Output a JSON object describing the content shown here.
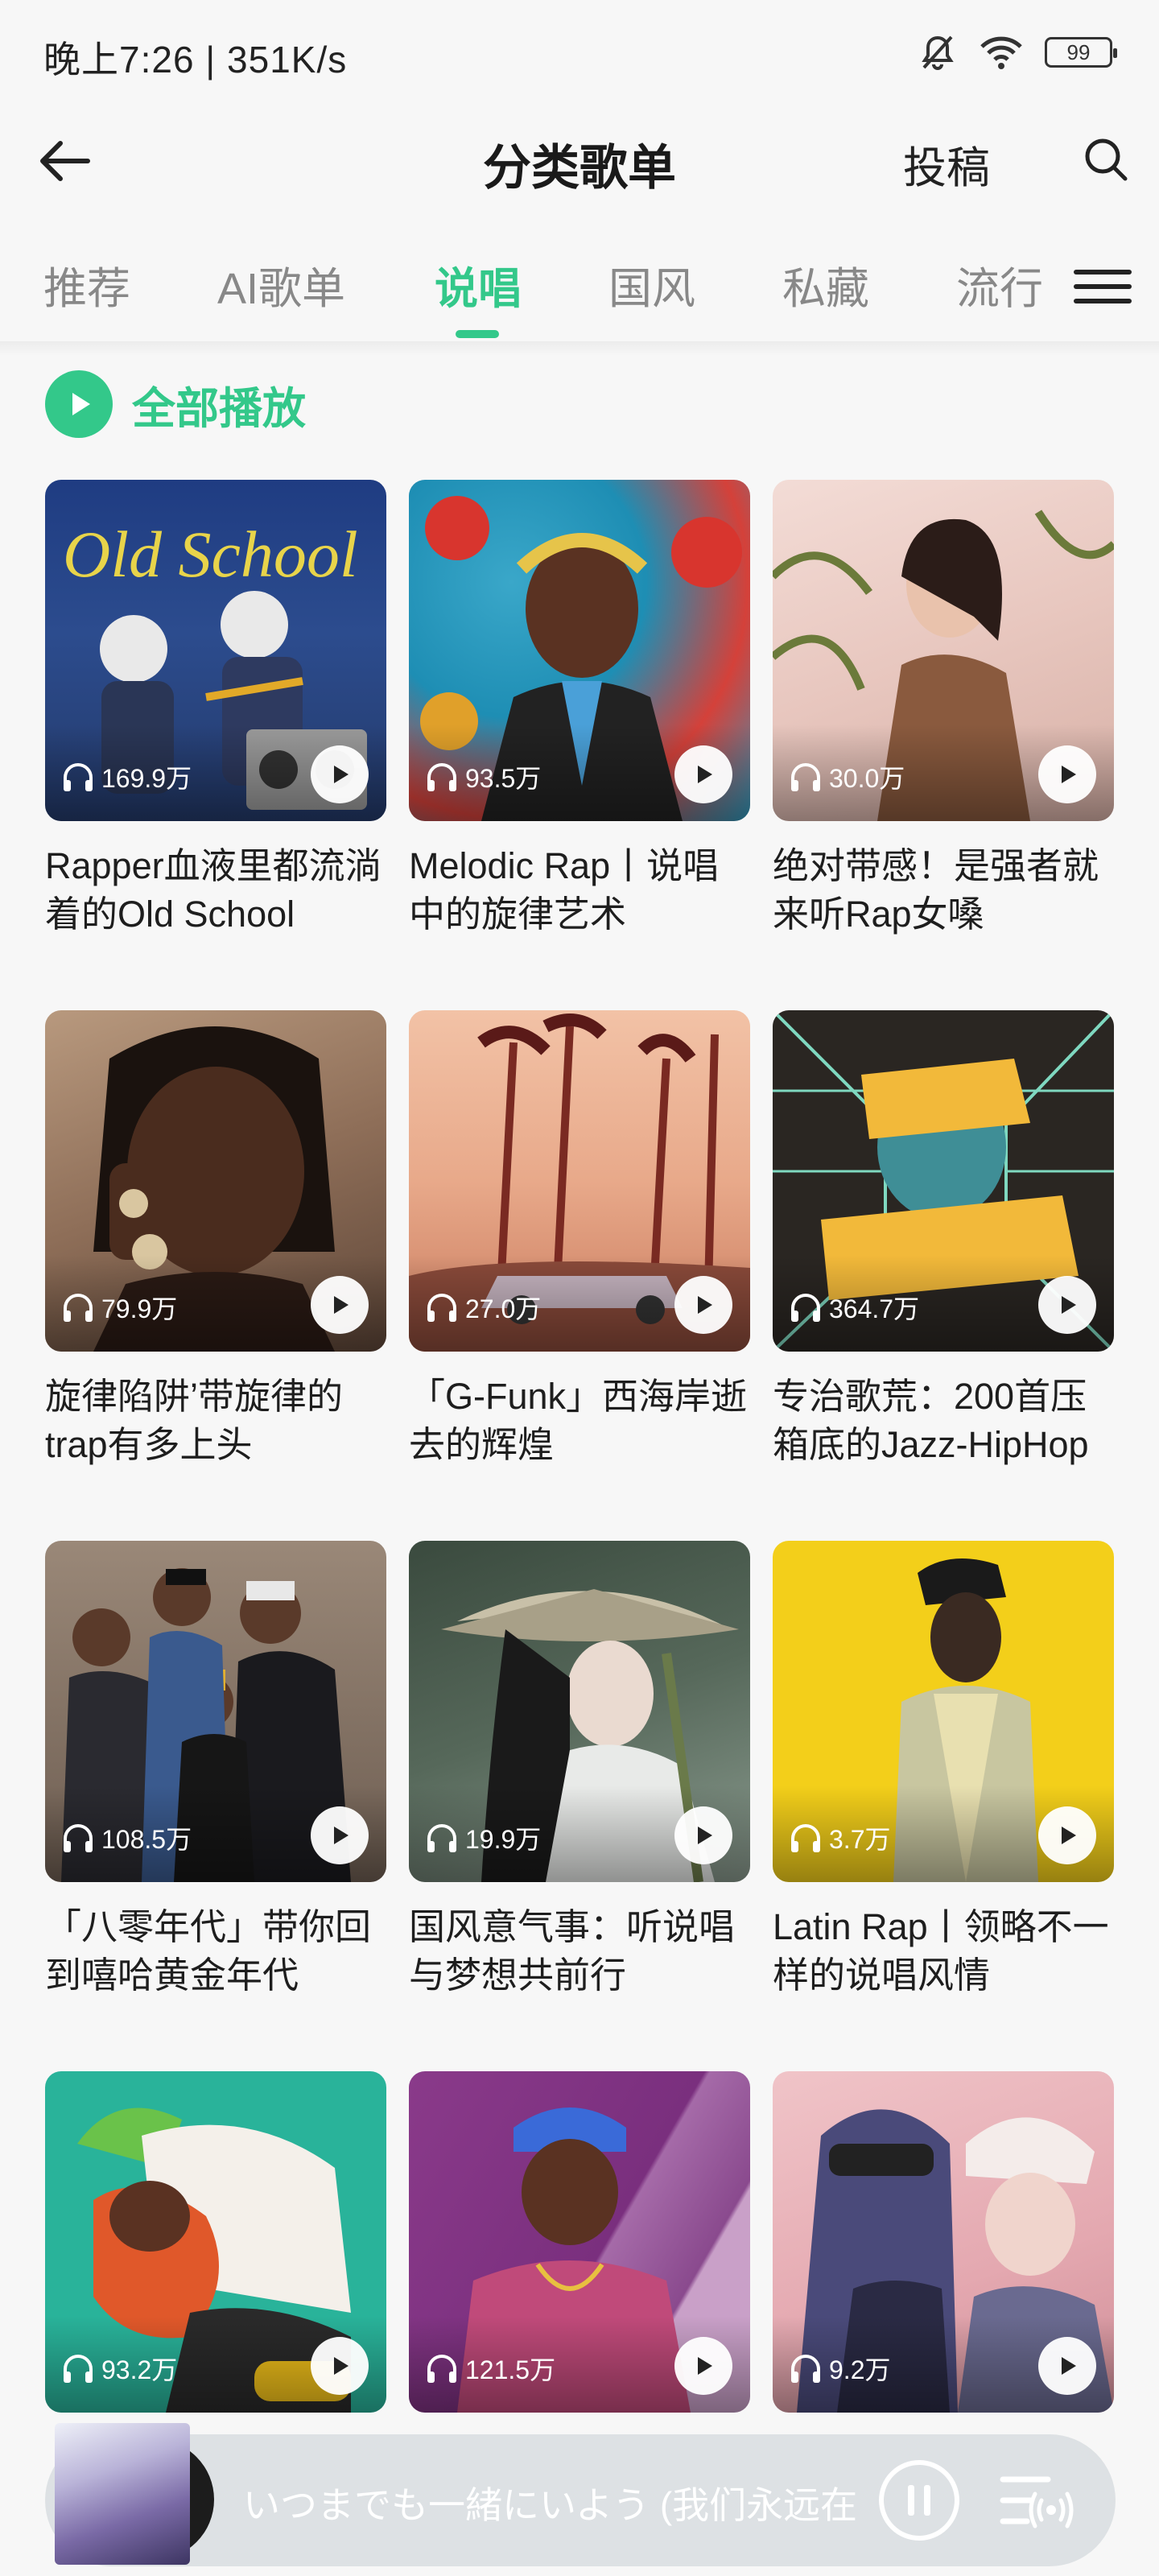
{
  "status": {
    "time_speed": "晚上7:26 | 351K/s",
    "battery": "99"
  },
  "header": {
    "title": "分类歌单",
    "submit_label": "投稿"
  },
  "tabs": [
    {
      "label": "推荐",
      "active": false
    },
    {
      "label": "AI歌单",
      "active": false
    },
    {
      "label": "说唱",
      "active": true
    },
    {
      "label": "国风",
      "active": false
    },
    {
      "label": "私藏",
      "active": false
    },
    {
      "label": "流行",
      "active": false
    }
  ],
  "play_all_label": "全部播放",
  "playlists": [
    {
      "plays": "169.9万",
      "title": "Rapper血液里都流淌着的Old School"
    },
    {
      "plays": "93.5万",
      "title": "Melodic Rap丨说唱中的旋律艺术"
    },
    {
      "plays": "30.0万",
      "title": "绝对带感！是强者就来听Rap女嗓"
    },
    {
      "plays": "79.9万",
      "title": "旋律陷阱’带旋律的trap有多上头"
    },
    {
      "plays": "27.0万",
      "title": "「G-Funk」西海岸逝去的辉煌"
    },
    {
      "plays": "364.7万",
      "title": "专治歌荒：200首压箱底的Jazz-HipHop"
    },
    {
      "plays": "108.5万",
      "title": "「八零年代」带你回到嘻哈黄金年代"
    },
    {
      "plays": "19.9万",
      "title": "国风意气事：听说唱与梦想共前行"
    },
    {
      "plays": "3.7万",
      "title": "Latin Rap丨领略不一样的说唱风情"
    },
    {
      "plays": "93.2万",
      "title": ""
    },
    {
      "plays": "121.5万",
      "title": ""
    },
    {
      "plays": "9.2万",
      "title": ""
    }
  ],
  "player": {
    "song": "いつまでも一緒にいよう (我们永远在"
  },
  "colors": {
    "accent": "#33c88a",
    "background": "#f7f7f7"
  }
}
